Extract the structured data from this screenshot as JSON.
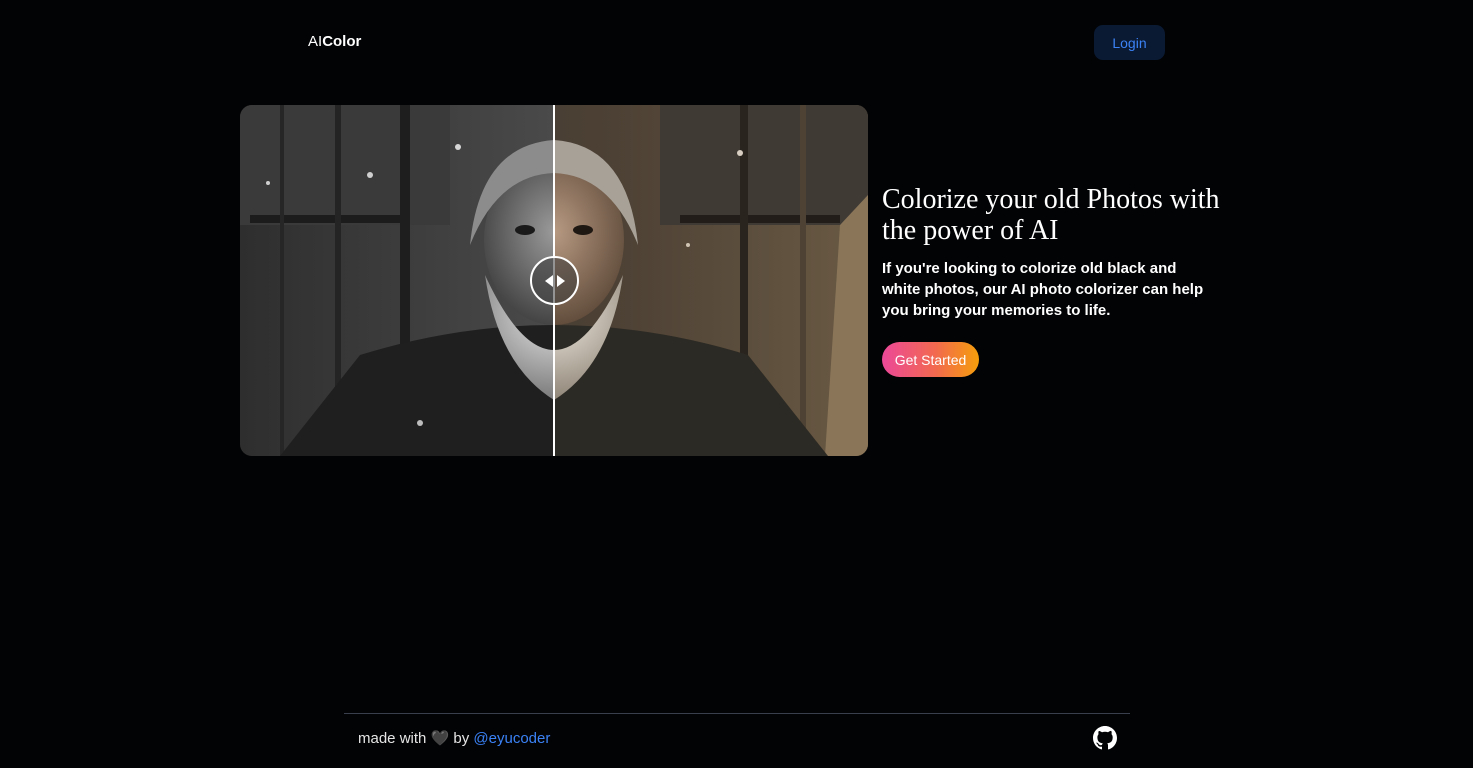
{
  "header": {
    "logo_prefix": "AI",
    "logo_strong": "Color",
    "login_label": "Login"
  },
  "hero": {
    "title": "Colorize your old Photos with the power of AI",
    "description": "If you're looking to colorize old black and white photos, our AI photo colorizer can help you bring your memories to life.",
    "cta_label": "Get Started",
    "compare_handle_icon": "left-right-arrows-icon",
    "slider_position": 0.5
  },
  "footer": {
    "made_with": "made with",
    "heart": "🖤",
    "by": "by",
    "author_link": "@eyucoder",
    "github_icon": "github-icon"
  },
  "colors": {
    "background": "#020305",
    "login_bg": "#0a1a33",
    "login_text": "#3b82f6",
    "link": "#3b82f6",
    "cta_gradient_start": "#ec4899",
    "cta_gradient_end": "#f59e0b"
  }
}
